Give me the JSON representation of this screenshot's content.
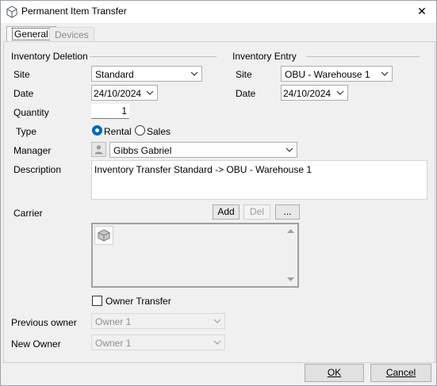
{
  "window": {
    "title": "Permanent Item Transfer",
    "close_glyph": "✕"
  },
  "tabs": [
    {
      "label": "General",
      "active": true
    },
    {
      "label": "Devices",
      "active": false
    }
  ],
  "deletion": {
    "group_label": "Inventory Deletion",
    "site_label": "Site",
    "site_value": "Standard",
    "date_label": "Date",
    "date_value": "24/10/2024"
  },
  "entry": {
    "group_label": "Inventory Entry",
    "site_label": "Site",
    "site_value": "OBU - Warehouse 1",
    "date_label": "Date",
    "date_value": "24/10/2024"
  },
  "quantity": {
    "label": "Quantity",
    "value": "1"
  },
  "type": {
    "label": "Type",
    "options": [
      {
        "label": "Rental",
        "checked": true
      },
      {
        "label": "Sales",
        "checked": false
      }
    ]
  },
  "manager": {
    "label": "Manager",
    "value": "Gibbs Gabriel",
    "icon": "person-icon"
  },
  "description": {
    "label": "Description",
    "value": "Inventory Transfer Standard -> OBU - Warehouse 1"
  },
  "carrier": {
    "label": "Carrier",
    "add_label": "Add",
    "del_label": "Del",
    "more_label": "...",
    "item_icon": "box-icon"
  },
  "owner_transfer": {
    "label": "Owner Transfer",
    "checked": false
  },
  "previous_owner": {
    "label": "Previous owner",
    "value": "Owner 1"
  },
  "new_owner": {
    "label": "New Owner",
    "value": "Owner 1"
  },
  "buttons": {
    "ok_label": "OK",
    "cancel_label": "Cancel"
  },
  "colors": {
    "accent": "#0067c0",
    "window_bg": "#f0f0f0",
    "disabled_text": "#8f8f8f"
  }
}
